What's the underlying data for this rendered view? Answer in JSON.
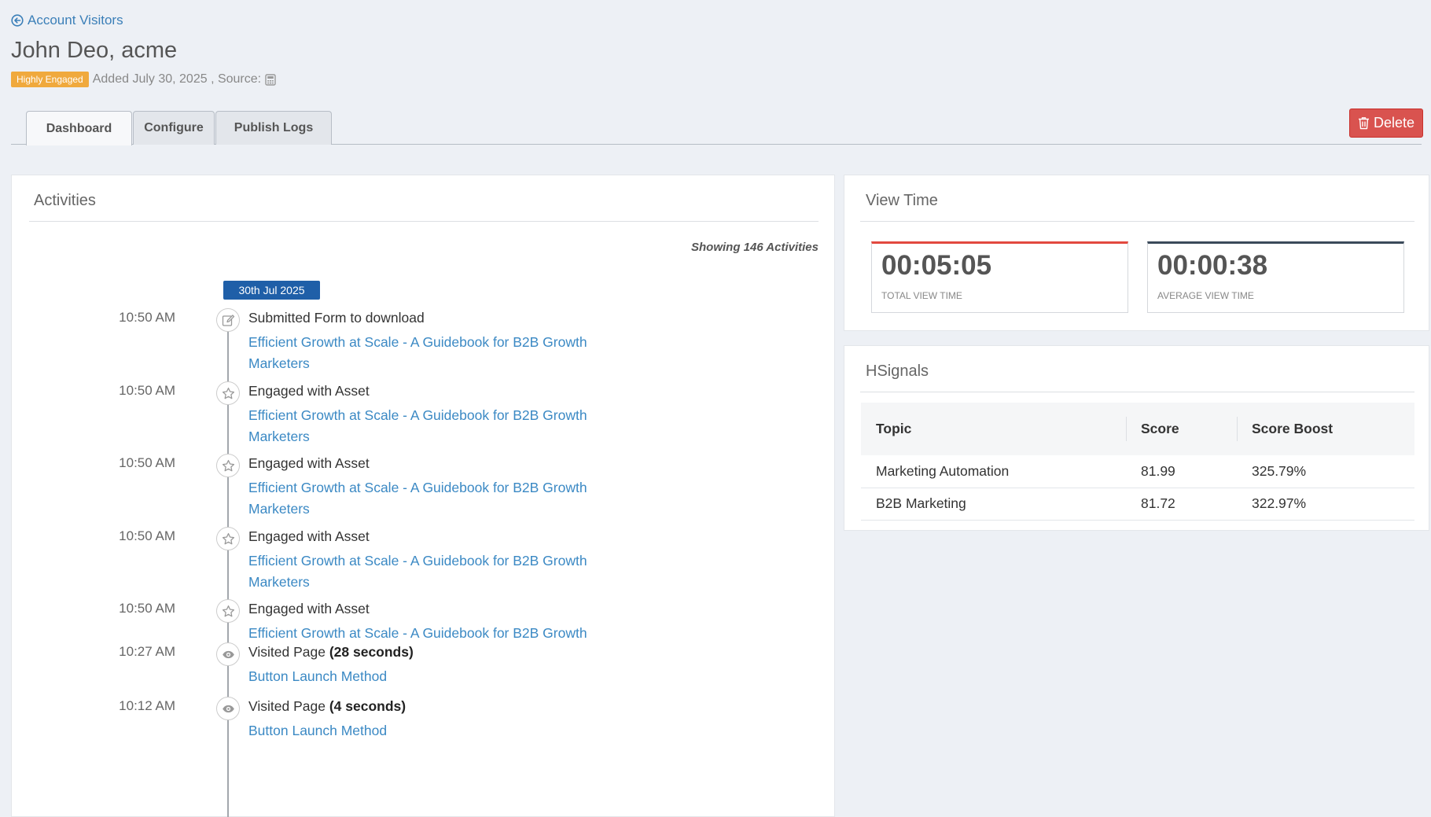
{
  "header": {
    "back_label": "Account Visitors",
    "title": "John Deo, acme",
    "badge": "Highly Engaged",
    "added_text": "Added July 30, 2025 , Source:"
  },
  "tabs": [
    {
      "label": "Dashboard",
      "active": true
    },
    {
      "label": "Configure",
      "active": false
    },
    {
      "label": "Publish Logs",
      "active": false
    }
  ],
  "delete_label": "Delete",
  "activities": {
    "title": "Activities",
    "showing": "Showing 146 Activities",
    "date": "30th Jul 2025",
    "items": [
      {
        "time": "10:50 AM",
        "icon": "edit-icon",
        "title": "Submitted Form to download",
        "link": "Efficient Growth at Scale - A Guidebook for B2B Growth Marketers"
      },
      {
        "time": "10:50 AM",
        "icon": "star-icon",
        "title": "Engaged with Asset",
        "link": "Efficient Growth at Scale - A Guidebook for B2B Growth Marketers"
      },
      {
        "time": "10:50 AM",
        "icon": "star-icon",
        "title": "Engaged with Asset",
        "link": "Efficient Growth at Scale - A Guidebook for B2B Growth Marketers"
      },
      {
        "time": "10:50 AM",
        "icon": "star-icon",
        "title": "Engaged with Asset",
        "link": "Efficient Growth at Scale - A Guidebook for B2B Growth Marketers"
      },
      {
        "time": "10:50 AM",
        "icon": "star-icon",
        "title": "Engaged with Asset",
        "link": "Efficient Growth at Scale - A Guidebook for B2B Growth"
      },
      {
        "time": "10:27 AM",
        "icon": "eye-icon",
        "title": "Visited Page",
        "duration": "(28 seconds)",
        "link": "Button Launch Method"
      },
      {
        "time": "10:12 AM",
        "icon": "eye-icon",
        "title": "Visited Page",
        "duration": "(4 seconds)",
        "link": "Button Launch Method"
      }
    ]
  },
  "view_time": {
    "title": "View Time",
    "total_value": "00:05:05",
    "total_label": "TOTAL VIEW TIME",
    "average_value": "00:00:38",
    "average_label": "AVERAGE VIEW TIME"
  },
  "hsignals": {
    "title": "HSignals",
    "columns": [
      "Topic",
      "Score",
      "Score Boost"
    ],
    "rows": [
      [
        "Marketing Automation",
        "81.99",
        "325.79%"
      ],
      [
        "B2B Marketing",
        "81.72",
        "322.97%"
      ]
    ]
  }
}
